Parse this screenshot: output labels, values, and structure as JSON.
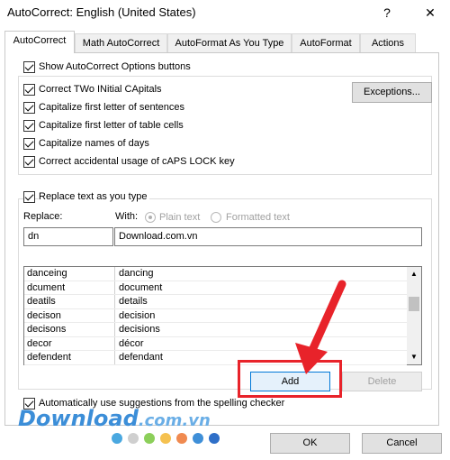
{
  "window": {
    "title": "AutoCorrect: English (United States)",
    "help_label": "?",
    "close_label": "✕"
  },
  "tabs": [
    "AutoCorrect",
    "Math AutoCorrect",
    "AutoFormat As You Type",
    "AutoFormat",
    "Actions"
  ],
  "options": {
    "show_buttons": "Show AutoCorrect Options buttons",
    "two_initial": "Correct TWo INitial CApitals",
    "first_sentence": "Capitalize first letter of sentences",
    "first_table": "Capitalize first letter of table cells",
    "names_days": "Capitalize names of days",
    "caps_lock": "Correct accidental usage of cAPS LOCK key",
    "exceptions_label": "Exceptions..."
  },
  "replace": {
    "checkbox_label": "Replace text as you type",
    "replace_label": "Replace:",
    "with_label": "With:",
    "plain_text": "Plain text",
    "formatted_text": "Formatted text",
    "replace_value": "dn",
    "with_value": "Download.com.vn"
  },
  "entries": [
    {
      "from": "danceing",
      "to": "dancing"
    },
    {
      "from": "dcument",
      "to": "document"
    },
    {
      "from": "deatils",
      "to": "details"
    },
    {
      "from": "decison",
      "to": "decision"
    },
    {
      "from": "decisons",
      "to": "decisions"
    },
    {
      "from": "decor",
      "to": "décor"
    },
    {
      "from": "defendent",
      "to": "defendant"
    }
  ],
  "actions": {
    "add_label": "Add",
    "delete_label": "Delete",
    "spelling_label": "Automatically use suggestions from the spelling checker",
    "ok_label": "OK",
    "cancel_label": "Cancel"
  },
  "watermark": {
    "text_main": "Download",
    "text_suffix": ".com.vn",
    "dot_colors": [
      "#4aa8e0",
      "#cfcfcf",
      "#8ccf5a",
      "#f5c150",
      "#f08a50",
      "#3f8fd8",
      "#2f6fc8"
    ]
  },
  "highlight_color": "#e8232a"
}
